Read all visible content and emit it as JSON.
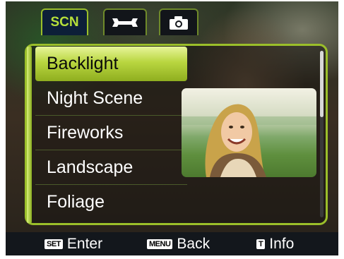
{
  "tabs": [
    {
      "label": "SCN",
      "icon": "scene-mode-tab"
    },
    {
      "label": "",
      "icon": "wrench-icon"
    },
    {
      "label": "",
      "icon": "camera-icon"
    }
  ],
  "menu": {
    "items": [
      {
        "label": "Backlight",
        "selected": true
      },
      {
        "label": "Night Scene"
      },
      {
        "label": "Fireworks"
      },
      {
        "label": "Landscape"
      },
      {
        "label": "Foliage"
      }
    ]
  },
  "scroll": {
    "position": 0,
    "visible_fraction": 0.4
  },
  "bottom_bar": {
    "enter": {
      "key": "SET",
      "label": "Enter"
    },
    "back": {
      "key": "MENU",
      "label": "Back"
    },
    "info": {
      "key": "T",
      "label": "Info"
    }
  },
  "colors": {
    "accent": "#9bbf2a",
    "selected": "#b9d640",
    "tab_active_bg": "#0d1f38",
    "bar_bg": "#13171c"
  }
}
